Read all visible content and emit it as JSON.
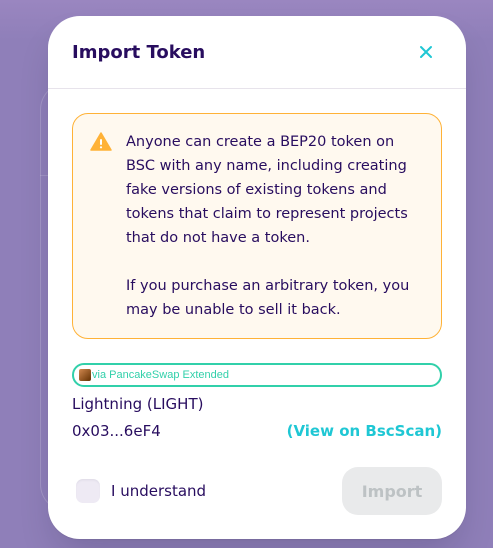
{
  "modal": {
    "title": "Import Token"
  },
  "warning": {
    "paragraph1": "Anyone can create a BEP20 token on BSC with any name, including creating fake versions of existing tokens and tokens that claim to represent projects that do not have a token.",
    "paragraph2": "If you purchase an arbitrary token, you may be unable to sell it back."
  },
  "source": {
    "label": "via PancakeSwap Extended"
  },
  "token": {
    "name": "Lightning  (LIGHT)",
    "address": "0x03...6eF4",
    "scan_link": "(View on BscScan)"
  },
  "confirm": {
    "label": "I understand",
    "checked": false
  },
  "actions": {
    "import_label": "Import",
    "import_disabled": true
  },
  "colors": {
    "text": "#280d5f",
    "accent": "#1fc7d4",
    "success": "#31d0aa",
    "warning": "#ffb237",
    "disabled_bg": "#e9eaeb",
    "disabled_text": "#bdc2c4"
  },
  "icons": {
    "close": "close-icon",
    "warning": "warning-icon",
    "source_logo": "pancakeswap-logo-icon"
  }
}
